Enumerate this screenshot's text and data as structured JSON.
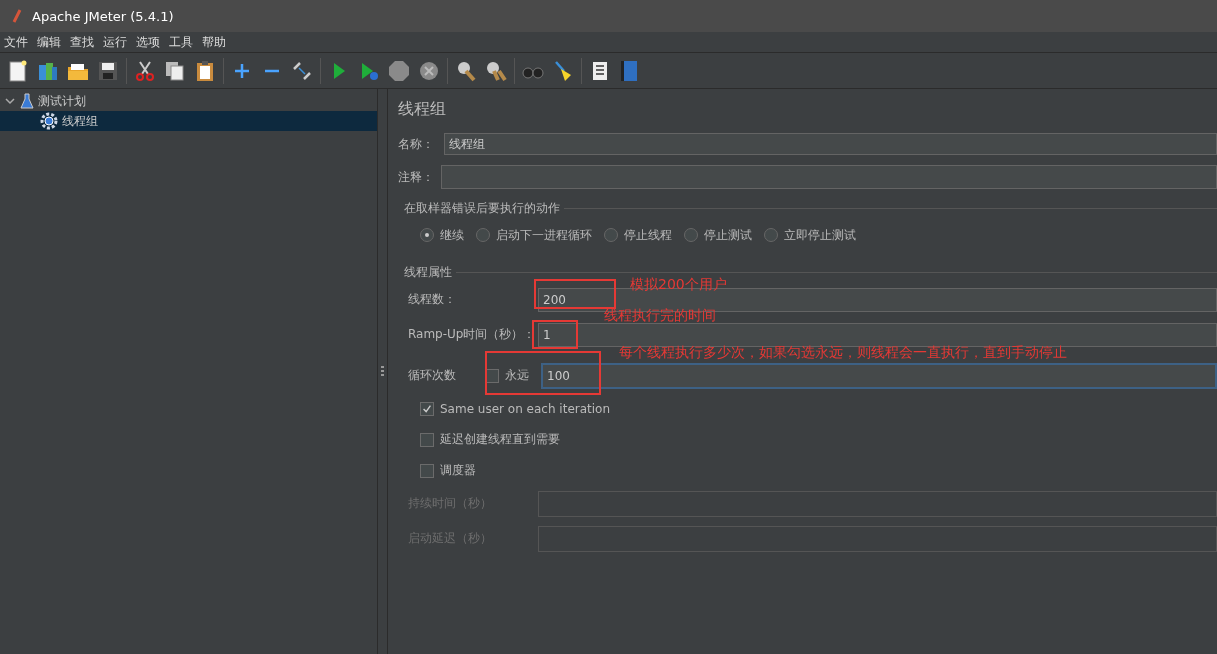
{
  "window": {
    "title": "Apache JMeter (5.4.1)"
  },
  "menu": [
    "文件",
    "编辑",
    "查找",
    "运行",
    "选项",
    "工具",
    "帮助"
  ],
  "tree": [
    {
      "label": "测试计划",
      "expanded": true,
      "selected": false,
      "children": [
        {
          "label": "线程组",
          "selected": true
        }
      ]
    }
  ],
  "panel": {
    "title": "线程组",
    "name_field": {
      "label": "名称：",
      "value": "线程组"
    },
    "comment_field": {
      "label": "注释："
    },
    "error_action": {
      "legend": "在取样器错误后要执行的动作",
      "options": [
        {
          "label": "继续",
          "selected": true
        },
        {
          "label": "启动下一进程循环",
          "selected": false
        },
        {
          "label": "停止线程",
          "selected": false
        },
        {
          "label": "停止测试",
          "selected": false
        },
        {
          "label": "立即停止测试",
          "selected": false
        }
      ]
    },
    "thread_properties": {
      "legend": "线程属性",
      "fields": [
        {
          "label": "线程数：",
          "value": "200",
          "annotation": "模拟200个用户"
        },
        {
          "label": "Ramp-Up时间（秒）：",
          "value": "1",
          "annotation": "线程执行完的时间"
        }
      ],
      "loop": {
        "label": "循环次数",
        "forever": {
          "label": "永远",
          "checked": false
        },
        "value": "100",
        "focused": true,
        "annotation": "每个线程执行多少次，如果勾选永远，则线程会一直执行，直到手动停止"
      },
      "checkboxes": [
        {
          "label": "Same user on each iteration",
          "checked": true
        },
        {
          "label": "延迟创建线程直到需要",
          "checked": false
        },
        {
          "label": "调度器",
          "checked": false
        }
      ],
      "scheduler_fields": [
        {
          "label": "持续时间（秒）",
          "disabled": true
        },
        {
          "label": "启动延迟（秒）",
          "disabled": true
        }
      ]
    }
  }
}
